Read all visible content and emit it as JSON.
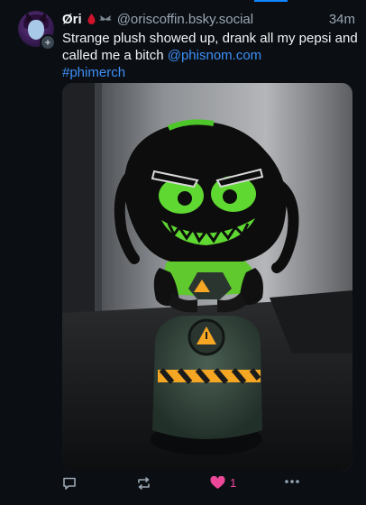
{
  "post": {
    "display_name": "Øri",
    "handle": "@oriscoffin.bsky.social",
    "time": "34m",
    "text_plain": "Strange plush showed up, drank all my pepsi and called me a bitch ",
    "mention": "@phisnom.com",
    "hashtag": "#phimerch",
    "image_alt": "Photo of a black and green plush character with angry green eyes sitting on a dark surface"
  },
  "actions": {
    "reply_count": "",
    "repost_count": "",
    "like_count": "1"
  },
  "colors": {
    "background": "#0b0f14",
    "link": "#3d8ff5",
    "like": "#ec4899",
    "muted": "#9aa6b2"
  },
  "icons": [
    "blood-drop-icon",
    "wings-icon",
    "follow-plus-icon",
    "reply-icon",
    "repost-icon",
    "heart-icon",
    "more-icon"
  ]
}
